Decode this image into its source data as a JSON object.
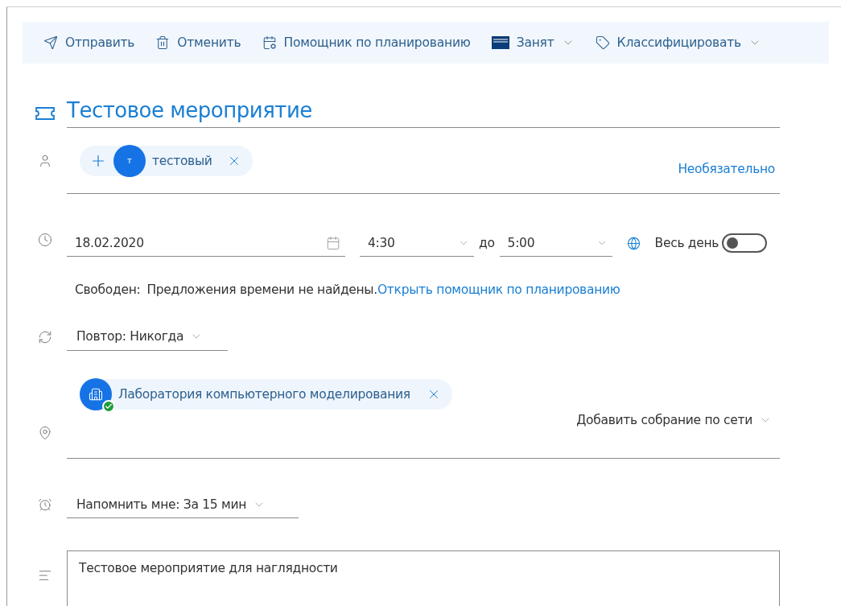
{
  "toolbar": [
    {
      "kind": "send",
      "label": "Отправить",
      "dropdown": false
    },
    {
      "kind": "cancel",
      "label": "Отменить",
      "dropdown": false
    },
    {
      "kind": "assistant",
      "label": "Помощник по планированию",
      "dropdown": false
    },
    {
      "kind": "busy",
      "label": "Занят",
      "dropdown": true
    },
    {
      "kind": "classify",
      "label": "Классифицировать",
      "dropdown": true
    }
  ],
  "title": "Тестовое мероприятие",
  "attendees": {
    "people": [
      {
        "initial": "т",
        "name": "тестовый"
      }
    ],
    "optional_link": "Необязательно"
  },
  "when": {
    "date": "18.02.2020",
    "start": "4:30",
    "to": "до",
    "end": "5:00",
    "all_day_label": "Весь день",
    "all_day": false
  },
  "availability": {
    "status": "Свободен:",
    "message": "Предложения времени не найдены.",
    "link": "Открыть помощник по планированию"
  },
  "repeat": "Повтор: Никогда",
  "location": {
    "rooms": [
      {
        "name": "Лаборатория компьютерного моделирования",
        "accepted": true
      }
    ],
    "online_meeting": "Добавить собрание по сети"
  },
  "reminder": "Напомнить мне: За 15 мин",
  "body": "Тестовое мероприятие для наглядности"
}
